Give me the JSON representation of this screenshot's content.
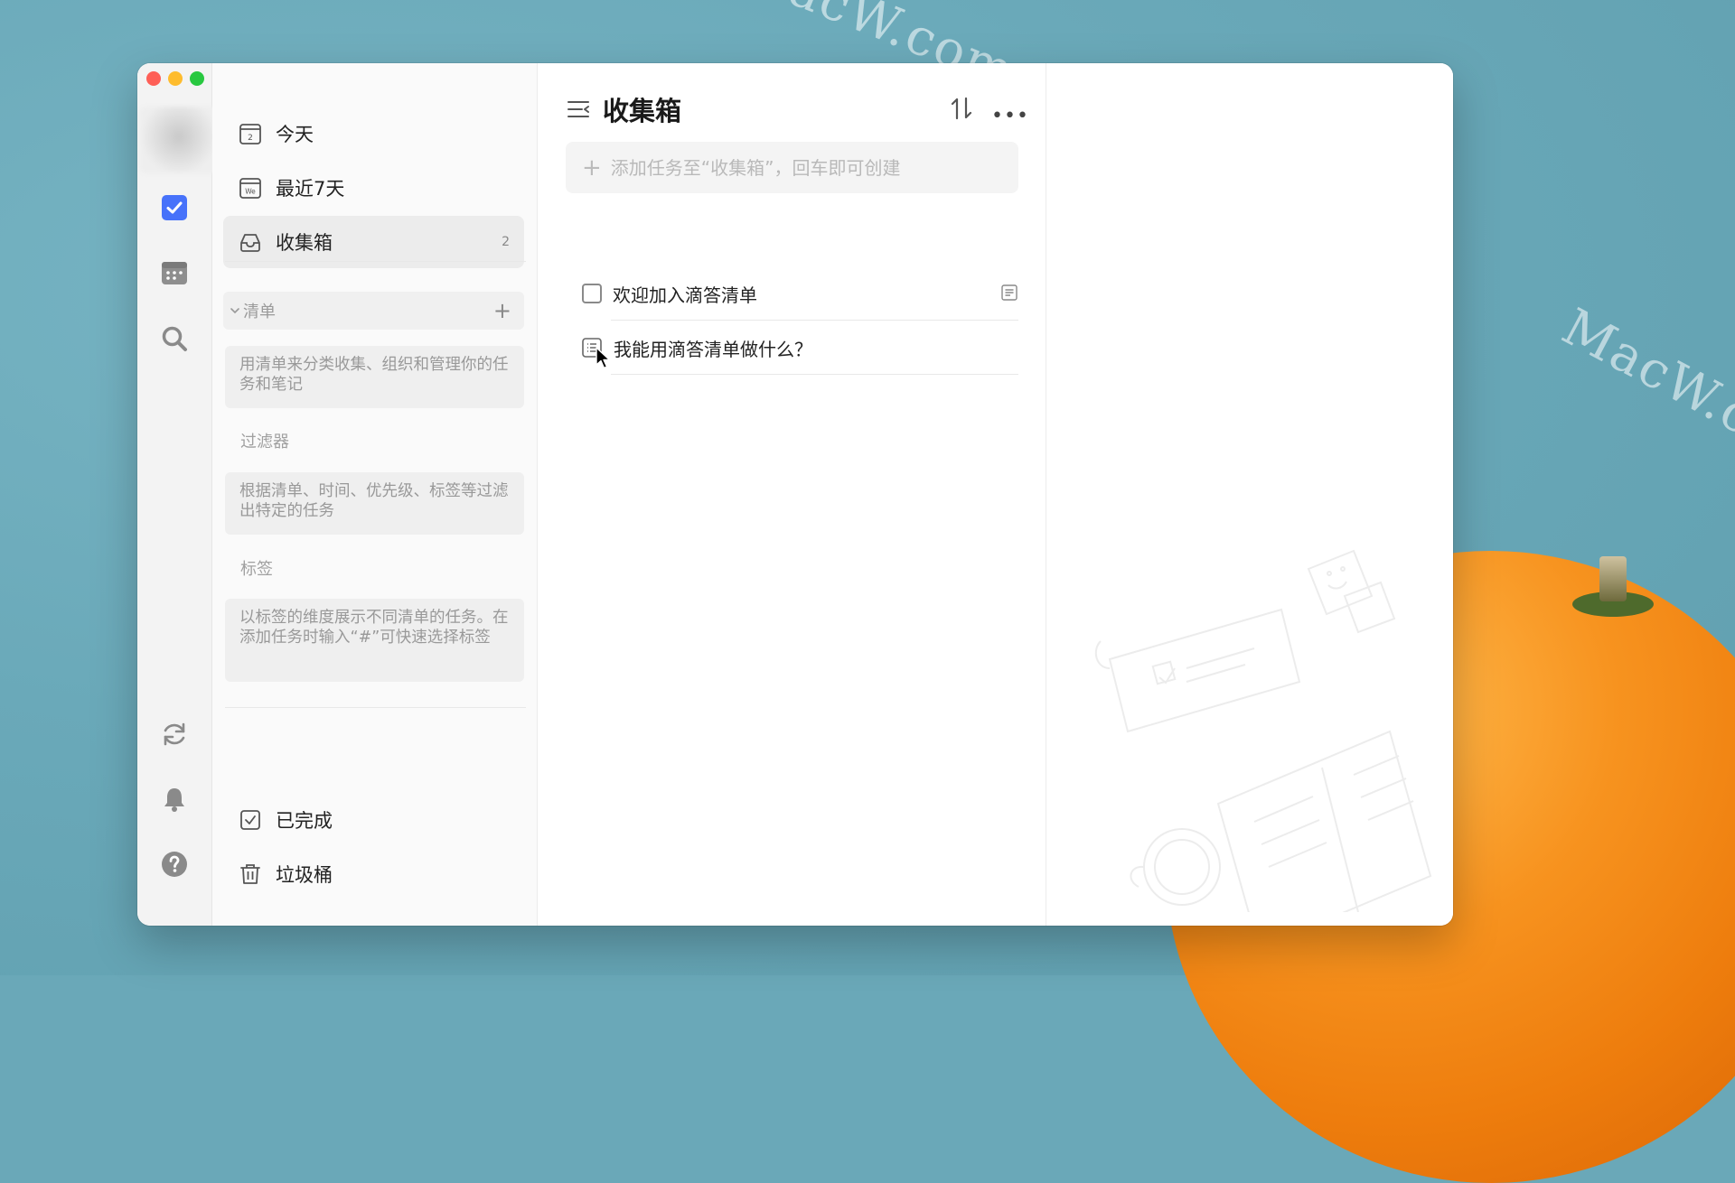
{
  "window": {
    "traffic_lights": [
      "close",
      "minimize",
      "zoom"
    ]
  },
  "rail": {
    "icons": [
      "task-icon",
      "calendar-icon",
      "search-icon",
      "sync-icon",
      "bell-icon",
      "help-icon"
    ]
  },
  "sidebar": {
    "smart_lists": [
      {
        "label": "今天",
        "icon": "calendar-day-icon"
      },
      {
        "label": "最近7天",
        "icon": "calendar-week-icon"
      },
      {
        "label": "收集箱",
        "icon": "inbox-icon",
        "count": "2"
      }
    ],
    "lists_section": {
      "label": "清单",
      "add": "+",
      "hint": "用清单来分类收集、组织和管理你的任务和笔记"
    },
    "filters_section": {
      "label": "过滤器",
      "hint": "根据清单、时间、优先级、标签等过滤出特定的任务"
    },
    "tags_section": {
      "label": "标签",
      "hint": "以标签的维度展示不同清单的任务。在添加任务时输入“#”可快速选择标签"
    },
    "bottom": [
      {
        "label": "已完成",
        "icon": "completed-icon"
      },
      {
        "label": "垃圾桶",
        "icon": "trash-icon"
      }
    ]
  },
  "main": {
    "title": "收集箱",
    "add_placeholder": "添加任务至“收集箱”，回车即可创建",
    "tasks": [
      {
        "label": "欢迎加入滴答清单",
        "type": "checkbox",
        "has_note": true
      },
      {
        "label": "我能用滴答清单做什么？",
        "type": "note"
      }
    ]
  },
  "watermarks": [
    "MacW.com",
    "MacW.c"
  ],
  "colors": {
    "accent": "#4772fa",
    "desktop": "#6aa8b8",
    "orange": "#f7931f"
  }
}
